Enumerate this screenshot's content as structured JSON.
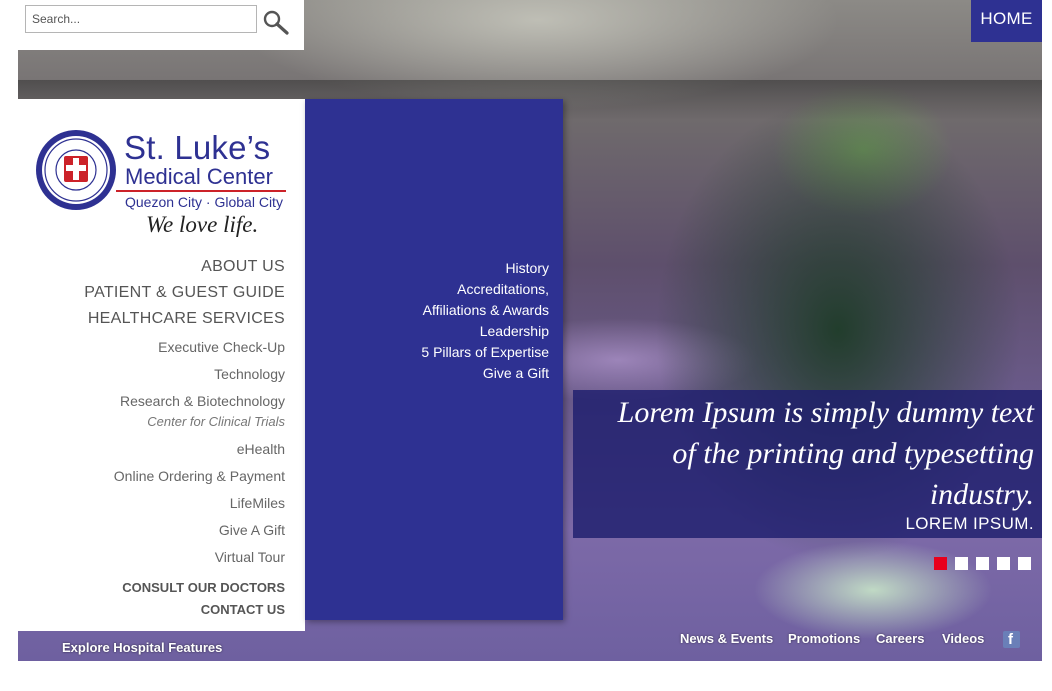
{
  "search": {
    "placeholder": "Search..."
  },
  "home_label": "HOME",
  "logo": {
    "title": "St. Luke’s",
    "subtitle": "Medical Center",
    "cities": "Quezon City · Global City",
    "tagline": "We love life.",
    "seal_text": "ST. LUKE'S MEDICAL CENTER · PHILIPPINES"
  },
  "nav": {
    "main": [
      "ABOUT US",
      "PATIENT & GUEST GUIDE",
      "HEALTHCARE SERVICES"
    ],
    "services": [
      "Executive Check-Up",
      "Technology",
      "Research & Biotechnology",
      "Center for Clinical Trials",
      "eHealth",
      "Online Ordering & Payment",
      "LifeMiles",
      "Give A Gift",
      "Virtual Tour"
    ],
    "bold": [
      "CONSULT OUR DOCTORS",
      "CONTACT US"
    ]
  },
  "about_submenu": [
    "History",
    "Accreditations,",
    "Affiliations & Awards",
    "Leadership",
    "5 Pillars of Expertise",
    "Give a Gift"
  ],
  "slide": {
    "caption_lines": [
      "Lorem Ipsum is simply dummy text",
      "of the printing and typesetting",
      "industry."
    ],
    "caption_small": "LOREM IPSUM.",
    "active_dot_color": "#e8001c",
    "dot_count": 5,
    "active_index": 0
  },
  "bottom_links": [
    "News & Events",
    "Promotions",
    "Careers",
    "Videos"
  ],
  "explore_label": "Explore Hospital Features",
  "colors": {
    "brand_blue": "#2e3192",
    "brand_red": "#cc2229"
  }
}
